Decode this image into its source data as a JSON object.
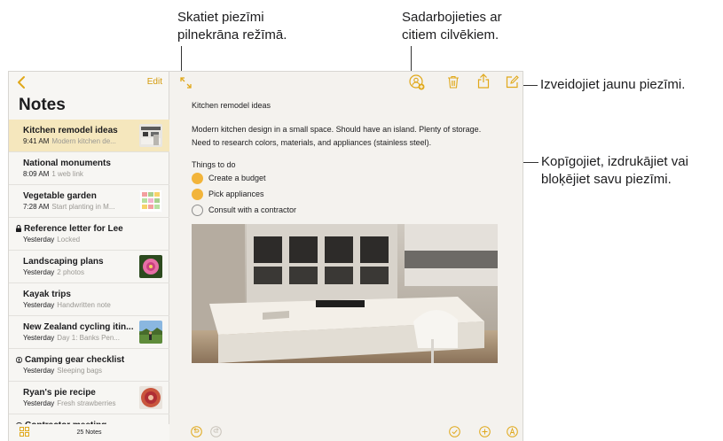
{
  "callouts": {
    "fullscreen": [
      "Skatiet piezīmi",
      "pilnekrāna režīmā."
    ],
    "collaborate": [
      "Sadarbojieties ar",
      "citiem cilvēkiem."
    ],
    "new_note": "Izveidojiet jaunu piezīmi.",
    "share": [
      "Kopīgojiet, izdrukājiet vai",
      "bloķējiet savu piezīmi."
    ]
  },
  "sidebar": {
    "edit_label": "Edit",
    "title": "Notes",
    "note_count": "25 Notes",
    "notes": [
      {
        "title": "Kitchen remodel ideas",
        "time": "9:41 AM",
        "preview": "Modern kitchen de...",
        "selected": true,
        "thumb": "kitchen-thumb"
      },
      {
        "title": "National monuments",
        "time": "8:09 AM",
        "preview": "1 web link"
      },
      {
        "title": "Vegetable garden",
        "time": "7:28 AM",
        "preview": "Start planting in M...",
        "thumb": "garden-thumb"
      },
      {
        "title": "Reference letter for Lee",
        "time": "Yesterday",
        "preview": "Locked",
        "locked": true
      },
      {
        "title": "Landscaping plans",
        "time": "Yesterday",
        "preview": "2 photos",
        "thumb": "flower-thumb"
      },
      {
        "title": "Kayak trips",
        "time": "Yesterday",
        "preview": "Handwritten note"
      },
      {
        "title": "New Zealand cycling itin...",
        "time": "Yesterday",
        "preview": "Day 1: Banks Pen...",
        "thumb": "cycling-thumb"
      },
      {
        "title": "Camping gear checklist",
        "time": "Yesterday",
        "preview": "Sleeping bags",
        "shared": true
      },
      {
        "title": "Ryan's pie recipe",
        "time": "Yesterday",
        "preview": "Fresh strawberries",
        "thumb": "pie-thumb"
      },
      {
        "title": "Contractor meeting",
        "time": "",
        "preview": "",
        "shared": true
      }
    ]
  },
  "editor": {
    "title": "Kitchen remodel ideas",
    "body": "Modern kitchen design in a small space. Should have an island. Plenty of storage. Need to research colors, materials, and appliances (stainless steel).",
    "checklist_heading": "Things to do",
    "checklist": [
      {
        "text": "Create a budget",
        "done": true
      },
      {
        "text": "Pick appliances",
        "done": true
      },
      {
        "text": "Consult with a contractor",
        "done": false
      }
    ]
  },
  "colors": {
    "accent": "#e0a81a",
    "selected_row": "#f5e7bd"
  }
}
